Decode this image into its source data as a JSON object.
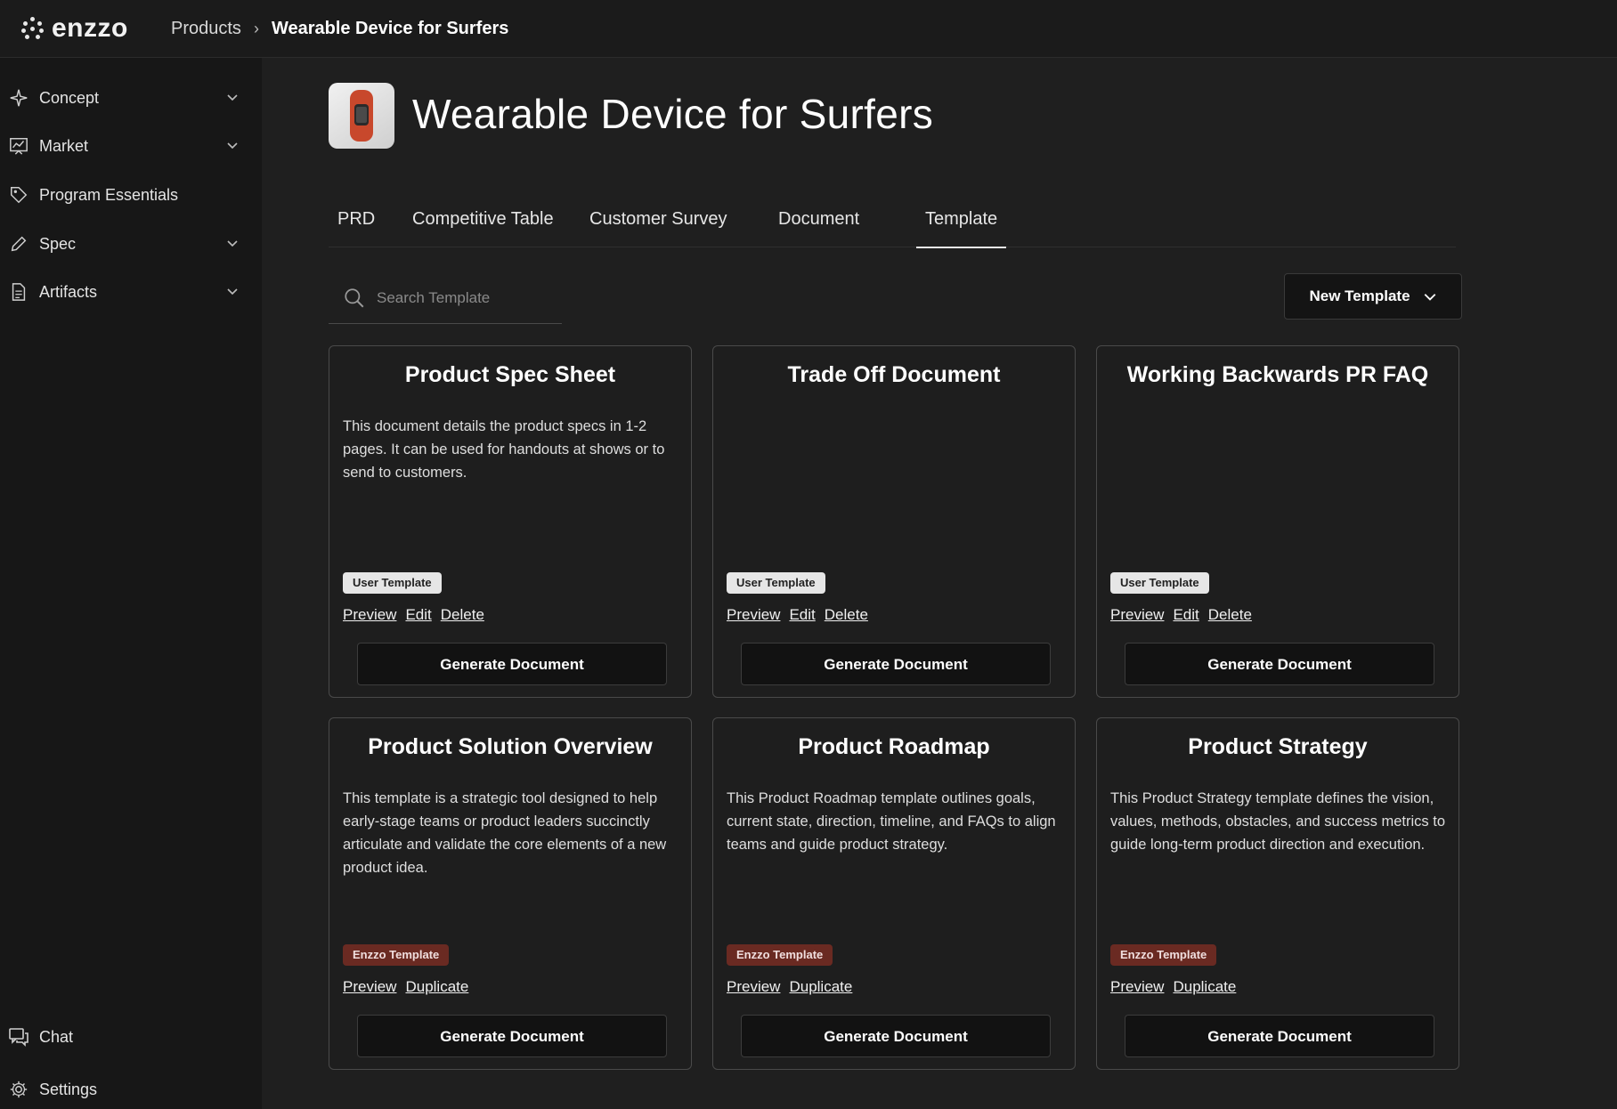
{
  "app": {
    "name": "enzzo"
  },
  "breadcrumb": {
    "root": "Products",
    "separator": "›",
    "current": "Wearable Device for Surfers"
  },
  "sidebar": {
    "items": [
      {
        "label": "Concept",
        "icon": "sparkle-icon",
        "expandable": true
      },
      {
        "label": "Market",
        "icon": "chart-board-icon",
        "expandable": true
      },
      {
        "label": "Program Essentials",
        "icon": "tag-icon",
        "expandable": false
      },
      {
        "label": "Spec",
        "icon": "pencil-icon",
        "expandable": true
      },
      {
        "label": "Artifacts",
        "icon": "document-icon",
        "expandable": true
      }
    ],
    "bottom": [
      {
        "label": "Chat",
        "icon": "chat-icon"
      },
      {
        "label": "Settings",
        "icon": "gear-icon"
      }
    ]
  },
  "page": {
    "title": "Wearable Device for Surfers"
  },
  "tabs": [
    {
      "label": "PRD",
      "active": false
    },
    {
      "label": "Competitive Table",
      "active": false
    },
    {
      "label": "Customer Survey",
      "active": false
    },
    {
      "label": "Document",
      "active": false
    },
    {
      "label": "Template",
      "active": true
    }
  ],
  "search": {
    "placeholder": "Search Template"
  },
  "new_template": {
    "label": "New Template"
  },
  "cards": [
    {
      "title": "Product Spec Sheet",
      "description": "This document details the product specs in 1-2 pages. It can be used for handouts at shows or to send to customers.",
      "badge": "User Template",
      "badge_type": "user",
      "links": [
        "Preview",
        "Edit",
        "Delete"
      ],
      "button": "Generate Document"
    },
    {
      "title": "Trade Off Document",
      "description": "",
      "badge": "User Template",
      "badge_type": "user",
      "links": [
        "Preview",
        "Edit",
        "Delete"
      ],
      "button": "Generate Document"
    },
    {
      "title": "Working Backwards PR FAQ",
      "description": "",
      "badge": "User Template",
      "badge_type": "user",
      "links": [
        "Preview",
        "Edit",
        "Delete"
      ],
      "button": "Generate Document"
    },
    {
      "title": "Product Solution Overview",
      "description": "This template is a strategic tool designed to help early-stage teams or product leaders succinctly articulate and validate the core elements of a new product idea.",
      "badge": "Enzzo Template",
      "badge_type": "enzzo",
      "links": [
        "Preview",
        "Duplicate"
      ],
      "button": "Generate Document"
    },
    {
      "title": "Product Roadmap",
      "description": "This Product Roadmap template outlines goals, current state, direction, timeline, and FAQs to align teams and guide product strategy.",
      "badge": "Enzzo Template",
      "badge_type": "enzzo",
      "links": [
        "Preview",
        "Duplicate"
      ],
      "button": "Generate Document"
    },
    {
      "title": "Product Strategy",
      "description": "This Product Strategy template defines the vision, values, methods, obstacles, and success metrics to guide long-term product direction and execution.",
      "badge": "Enzzo Template",
      "badge_type": "enzzo",
      "links": [
        "Preview",
        "Duplicate"
      ],
      "button": "Generate Document"
    }
  ],
  "colors": {
    "background": "#1f1f1f",
    "sidebar": "#171717",
    "user_badge": "#e6e6e6",
    "enzzo_badge": "#6a2a22"
  }
}
